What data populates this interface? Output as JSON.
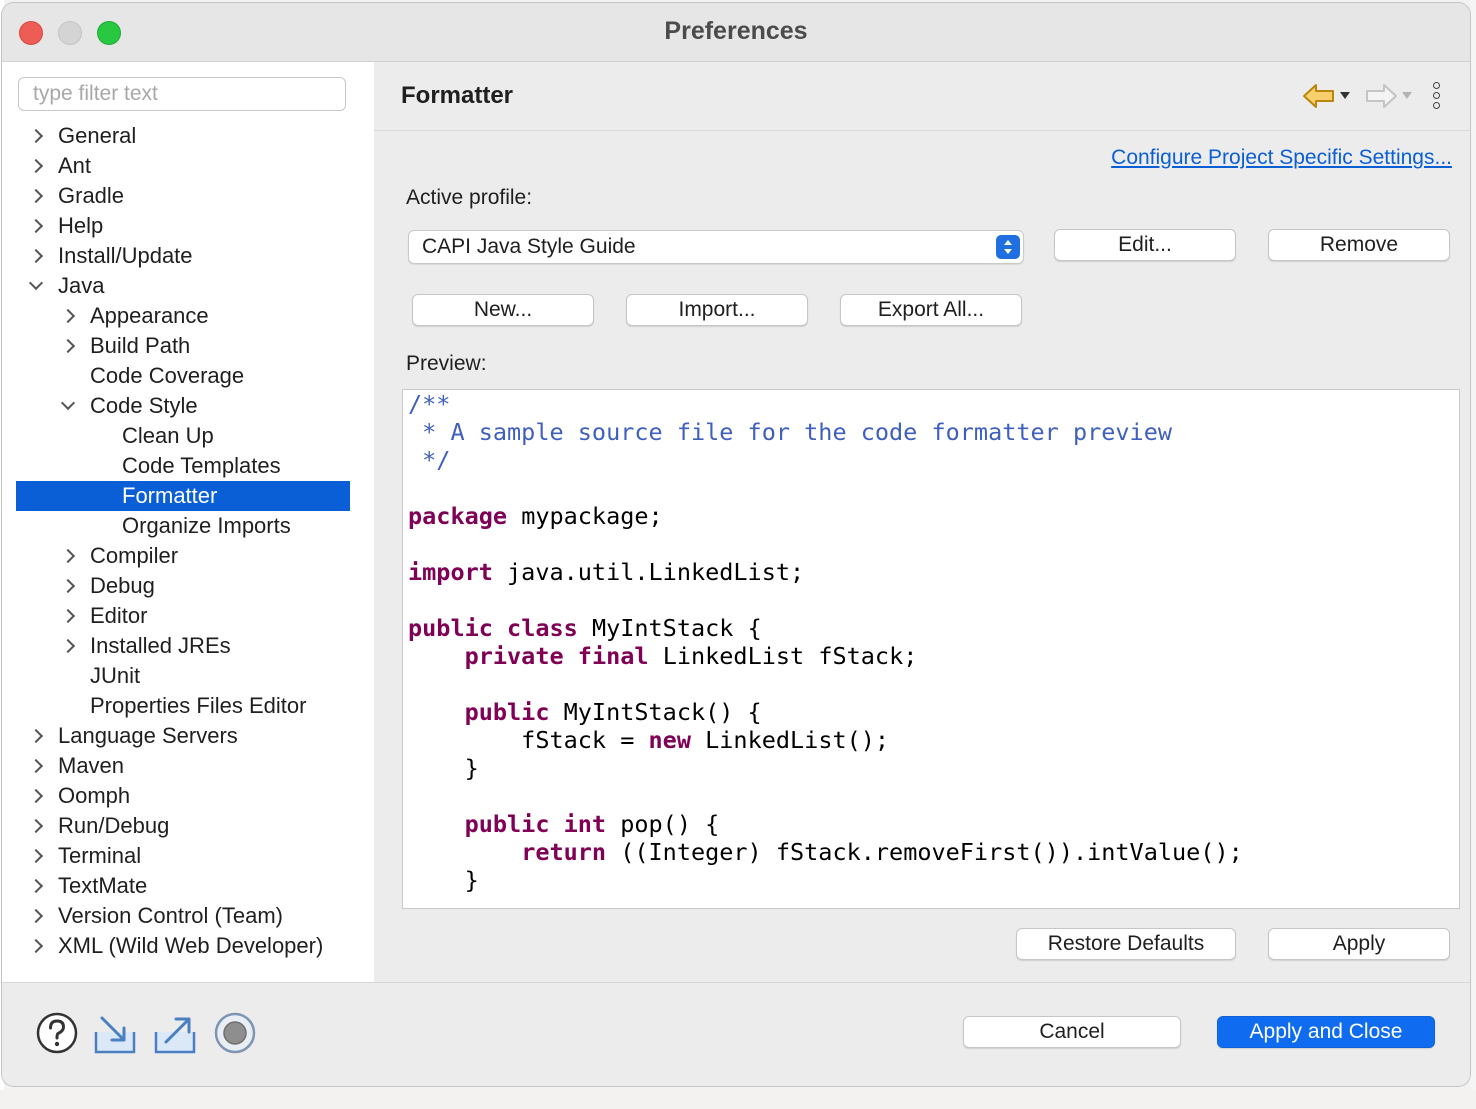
{
  "window": {
    "title": "Preferences"
  },
  "filter": {
    "placeholder": "type filter text",
    "value": ""
  },
  "tree": [
    {
      "label": "General",
      "level": 0,
      "expander": "collapsed"
    },
    {
      "label": "Ant",
      "level": 0,
      "expander": "collapsed"
    },
    {
      "label": "Gradle",
      "level": 0,
      "expander": "collapsed"
    },
    {
      "label": "Help",
      "level": 0,
      "expander": "collapsed"
    },
    {
      "label": "Install/Update",
      "level": 0,
      "expander": "collapsed"
    },
    {
      "label": "Java",
      "level": 0,
      "expander": "expanded"
    },
    {
      "label": "Appearance",
      "level": 1,
      "expander": "collapsed"
    },
    {
      "label": "Build Path",
      "level": 1,
      "expander": "collapsed"
    },
    {
      "label": "Code Coverage",
      "level": 1,
      "expander": "none"
    },
    {
      "label": "Code Style",
      "level": 1,
      "expander": "expanded"
    },
    {
      "label": "Clean Up",
      "level": 2,
      "expander": "none"
    },
    {
      "label": "Code Templates",
      "level": 2,
      "expander": "none"
    },
    {
      "label": "Formatter",
      "level": 2,
      "expander": "none",
      "selected": true
    },
    {
      "label": "Organize Imports",
      "level": 2,
      "expander": "none"
    },
    {
      "label": "Compiler",
      "level": 1,
      "expander": "collapsed"
    },
    {
      "label": "Debug",
      "level": 1,
      "expander": "collapsed"
    },
    {
      "label": "Editor",
      "level": 1,
      "expander": "collapsed"
    },
    {
      "label": "Installed JREs",
      "level": 1,
      "expander": "collapsed"
    },
    {
      "label": "JUnit",
      "level": 1,
      "expander": "none"
    },
    {
      "label": "Properties Files Editor",
      "level": 1,
      "expander": "none"
    },
    {
      "label": "Language Servers",
      "level": 0,
      "expander": "collapsed"
    },
    {
      "label": "Maven",
      "level": 0,
      "expander": "collapsed"
    },
    {
      "label": "Oomph",
      "level": 0,
      "expander": "collapsed"
    },
    {
      "label": "Run/Debug",
      "level": 0,
      "expander": "collapsed"
    },
    {
      "label": "Terminal",
      "level": 0,
      "expander": "collapsed"
    },
    {
      "label": "TextMate",
      "level": 0,
      "expander": "collapsed"
    },
    {
      "label": "Version Control (Team)",
      "level": 0,
      "expander": "collapsed"
    },
    {
      "label": "XML (Wild Web Developer)",
      "level": 0,
      "expander": "collapsed"
    }
  ],
  "page": {
    "title": "Formatter",
    "project_link": "Configure Project Specific Settings...",
    "active_profile_label": "Active profile:",
    "profile_value": "CAPI Java Style Guide",
    "buttons": {
      "edit": "Edit...",
      "remove": "Remove",
      "new": "New...",
      "import": "Import...",
      "export_all": "Export All..."
    },
    "preview_label": "Preview:"
  },
  "preview_code": [
    [
      {
        "t": "/**",
        "s": "comment"
      }
    ],
    [
      {
        "t": " * A sample source file for the code formatter preview",
        "s": "comment"
      }
    ],
    [
      {
        "t": " */",
        "s": "comment"
      }
    ],
    [],
    [
      {
        "t": "package",
        "s": "kw"
      },
      {
        "t": " mypackage;",
        "s": "plain"
      }
    ],
    [],
    [
      {
        "t": "import",
        "s": "kw"
      },
      {
        "t": " java.util.LinkedList;",
        "s": "plain"
      }
    ],
    [],
    [
      {
        "t": "public",
        "s": "kw"
      },
      {
        "t": " ",
        "s": "plain"
      },
      {
        "t": "class",
        "s": "kw"
      },
      {
        "t": " MyIntStack {",
        "s": "plain"
      }
    ],
    [
      {
        "t": "    ",
        "s": "plain"
      },
      {
        "t": "private",
        "s": "kw"
      },
      {
        "t": " ",
        "s": "plain"
      },
      {
        "t": "final",
        "s": "kw"
      },
      {
        "t": " LinkedList fStack;",
        "s": "plain"
      }
    ],
    [],
    [
      {
        "t": "    ",
        "s": "plain"
      },
      {
        "t": "public",
        "s": "kw"
      },
      {
        "t": " MyIntStack() {",
        "s": "plain"
      }
    ],
    [
      {
        "t": "        fStack = ",
        "s": "plain"
      },
      {
        "t": "new",
        "s": "kw"
      },
      {
        "t": " LinkedList();",
        "s": "plain"
      }
    ],
    [
      {
        "t": "    }",
        "s": "plain"
      }
    ],
    [],
    [
      {
        "t": "    ",
        "s": "plain"
      },
      {
        "t": "public",
        "s": "kw"
      },
      {
        "t": " ",
        "s": "plain"
      },
      {
        "t": "int",
        "s": "kw"
      },
      {
        "t": " pop() {",
        "s": "plain"
      }
    ],
    [
      {
        "t": "        ",
        "s": "plain"
      },
      {
        "t": "return",
        "s": "kw"
      },
      {
        "t": " ((Integer) fStack.removeFirst()).intValue();",
        "s": "plain"
      }
    ],
    [
      {
        "t": "    }",
        "s": "plain"
      }
    ]
  ],
  "page_buttons": {
    "restore_defaults": "Restore Defaults",
    "apply": "Apply"
  },
  "dialog_buttons": {
    "cancel": "Cancel",
    "apply_and_close": "Apply and Close"
  },
  "bottom_icons": [
    "help-icon",
    "import-preferences-icon",
    "export-preferences-icon",
    "record-icon"
  ],
  "colors": {
    "selection": "#0a5fd6",
    "link": "#0b5fd4",
    "primary_button": "#0f6cf0",
    "code_keyword": "#7f0055",
    "code_comment": "#3f5fbf"
  }
}
